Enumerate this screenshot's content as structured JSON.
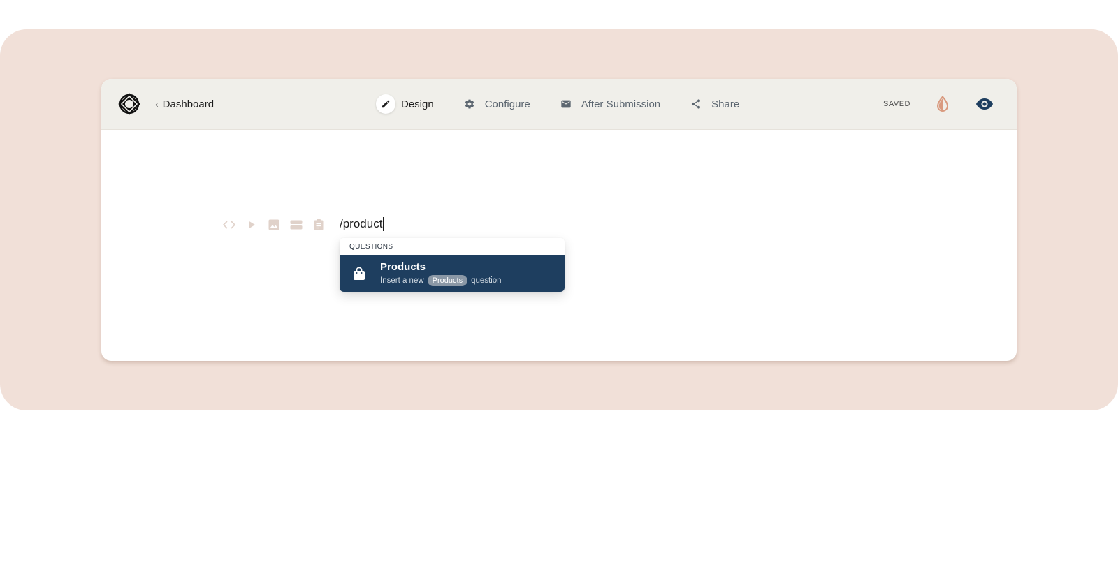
{
  "header": {
    "back_label": "Dashboard",
    "tabs": [
      {
        "label": "Design",
        "icon": "pencil-icon",
        "active": true
      },
      {
        "label": "Configure",
        "icon": "gear-icon",
        "active": false
      },
      {
        "label": "After Submission",
        "icon": "envelope-icon",
        "active": false
      },
      {
        "label": "Share",
        "icon": "share-icon",
        "active": false
      }
    ],
    "status": "SAVED"
  },
  "colors": {
    "backdrop": "#f1e0d8",
    "topbar": "#f0efea",
    "accent_navy": "#1e3e5f",
    "theme_icon": "#d99a7f"
  },
  "block_tools": [
    "code-icon",
    "play-icon",
    "image-icon",
    "layout-icon",
    "clipboard-icon"
  ],
  "editor": {
    "text": "/product"
  },
  "command_menu": {
    "section": "QUESTIONS",
    "items": [
      {
        "icon": "shopping-bag-icon",
        "title": "Products",
        "desc_before": "Insert a new",
        "desc_pill": "Products",
        "desc_after": "question"
      }
    ]
  }
}
